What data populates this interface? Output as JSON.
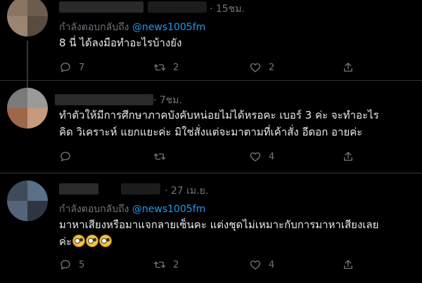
{
  "tweets": [
    {
      "time": "· 15ชม.",
      "reply_prefix": "กำลังตอบกลับถึง",
      "reply_handle": "@news1005fm",
      "text": "8 นี่ ได้ลงมือทำอะไรบ้างยัง",
      "replies": "7",
      "retweets": "2",
      "likes": "2"
    },
    {
      "time": "· 7ชม.",
      "text_line1": "ทำตัวให้มีการศึกษาภาคบังคับหน่อยไม่ได้หรอคะ เบอร์ 3 ค่ะ จะทำอะไร",
      "text_line2": "คิด วิเคราะห์ แยกแยะค่ะ มิใช่สั่งแต่จะมาตามที่เค้าสั่ง อีดอก อายค่ะ",
      "likes": "4"
    },
    {
      "time": "· 27 เม.ย.",
      "reply_prefix": "กำลังตอบกลับถึง",
      "reply_handle": "@news1005fm",
      "text_line1": "มาหาเสียงหรือมาแจกลายเซ็นคะ แต่งชุดไม่เหมาะกับการมาหาเสียงเลย",
      "text_line2": "ค่ะ",
      "replies": "5",
      "retweets": "2",
      "likes": "4"
    }
  ]
}
